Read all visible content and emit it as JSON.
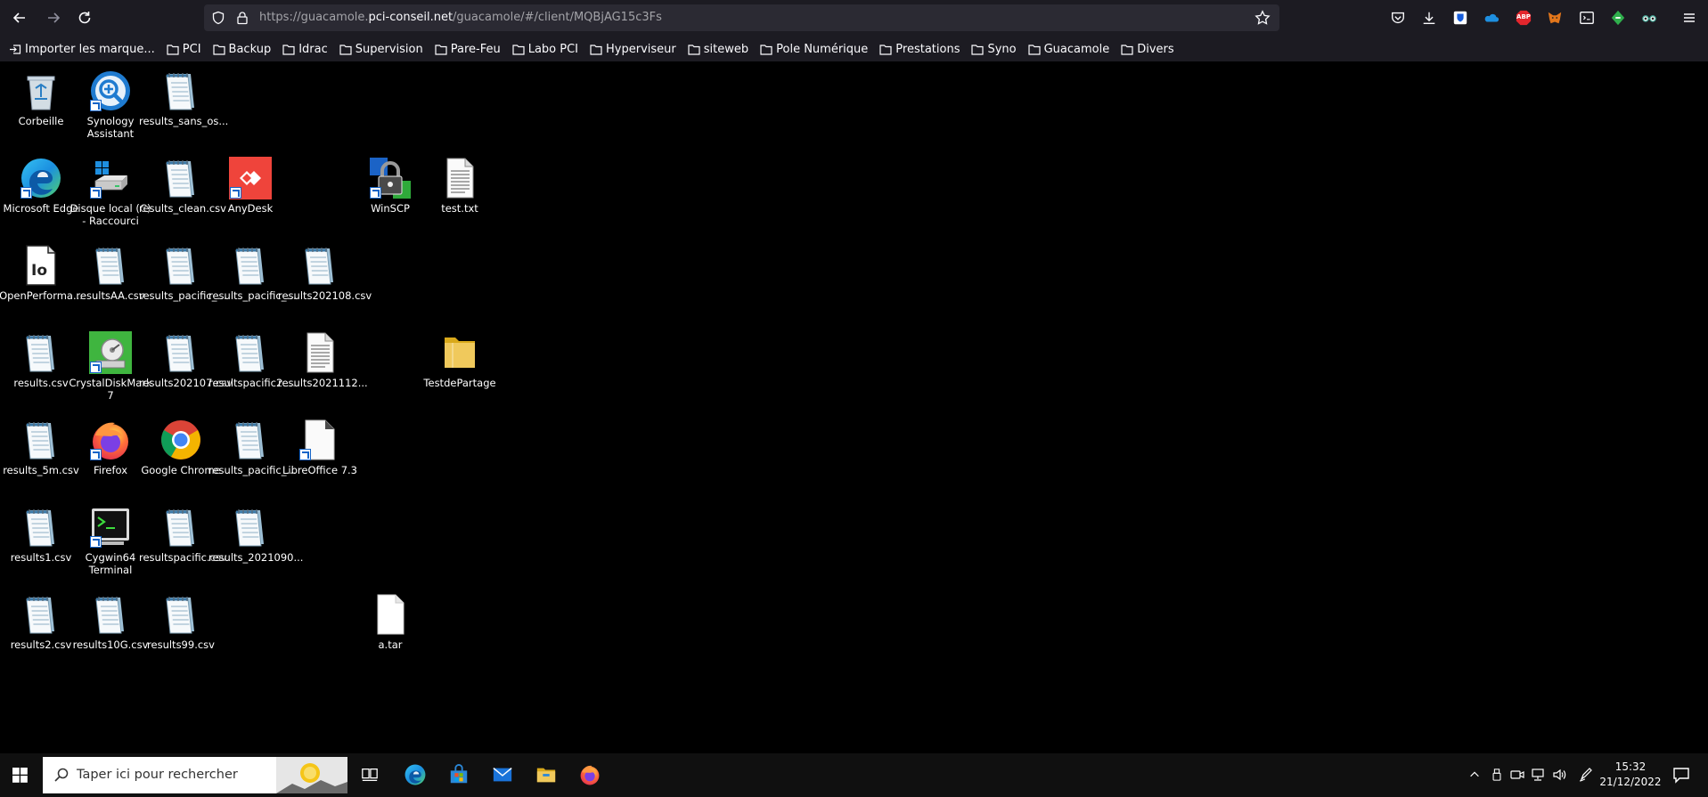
{
  "browser": {
    "url_prefix": "https://guacamole.",
    "url_host": "pci-conseil.net",
    "url_path": "/guacamole/#/client/MQBjAG15c3Fs",
    "extensions": [
      {
        "name": "pocket-icon",
        "label": ""
      },
      {
        "name": "download-icon",
        "label": ""
      },
      {
        "name": "bitwarden-icon",
        "label": ""
      },
      {
        "name": "onedrive-icon",
        "label": ""
      },
      {
        "name": "adblock-icon",
        "label": "ABP"
      },
      {
        "name": "metamask-icon",
        "label": ""
      },
      {
        "name": "devtools-icon",
        "label": ""
      },
      {
        "name": "green-extension-icon",
        "label": ""
      },
      {
        "name": "glasses-extension-icon",
        "label": ""
      }
    ]
  },
  "bookmarks": [
    {
      "label": "Importer les marque...",
      "type": "import"
    },
    {
      "label": "PCI",
      "type": "folder"
    },
    {
      "label": "Backup",
      "type": "folder"
    },
    {
      "label": "Idrac",
      "type": "folder"
    },
    {
      "label": "Supervision",
      "type": "folder"
    },
    {
      "label": "Pare-Feu",
      "type": "folder"
    },
    {
      "label": "Labo PCI",
      "type": "folder"
    },
    {
      "label": "Hyperviseur",
      "type": "folder"
    },
    {
      "label": "siteweb",
      "type": "folder"
    },
    {
      "label": "Pole Numérique",
      "type": "folder"
    },
    {
      "label": "Prestations",
      "type": "folder"
    },
    {
      "label": "Syno",
      "type": "folder"
    },
    {
      "label": "Guacamole",
      "type": "folder"
    },
    {
      "label": "Divers",
      "type": "folder"
    }
  ],
  "desktop_icons": [
    {
      "label": "Corbeille",
      "icon": "recycle-bin-icon",
      "shortcut": false
    },
    {
      "label": "Synology Assistant",
      "icon": "synology-assistant-icon",
      "shortcut": true
    },
    {
      "label": "results_sans_os...",
      "icon": "notepad-file-icon",
      "shortcut": false
    },
    {
      "label": "Microsoft Edge",
      "icon": "edge-icon",
      "shortcut": true
    },
    {
      "label": "Disque local (C) - Raccourci",
      "icon": "local-disk-icon",
      "shortcut": true
    },
    {
      "label": "results_clean.csv",
      "icon": "notepad-file-icon",
      "shortcut": false
    },
    {
      "label": "AnyDesk",
      "icon": "anydesk-icon",
      "shortcut": true
    },
    {
      "label": "WinSCP",
      "icon": "winscp-icon",
      "shortcut": true
    },
    {
      "label": "test.txt",
      "icon": "text-file-icon",
      "shortcut": false
    },
    {
      "label": "OpenPerforma...",
      "icon": "openperformance-icon",
      "shortcut": false
    },
    {
      "label": "resultsAA.csv",
      "icon": "notepad-file-icon",
      "shortcut": false
    },
    {
      "label": "results_pacific_...",
      "icon": "notepad-file-icon",
      "shortcut": false
    },
    {
      "label": "results_pacific_...",
      "icon": "notepad-file-icon",
      "shortcut": false
    },
    {
      "label": "results202108.csv",
      "icon": "notepad-file-icon",
      "shortcut": false
    },
    {
      "label": "results.csv",
      "icon": "notepad-file-icon",
      "shortcut": false
    },
    {
      "label": "CrystalDiskMark 7",
      "icon": "crystaldiskmark-icon",
      "shortcut": true
    },
    {
      "label": "results202107.csv",
      "icon": "notepad-file-icon",
      "shortcut": false
    },
    {
      "label": "resultspacific2....",
      "icon": "notepad-file-icon",
      "shortcut": false
    },
    {
      "label": "results2021112...",
      "icon": "text-file-icon",
      "shortcut": false
    },
    {
      "label": "TestdePartage",
      "icon": "folder-icon",
      "shortcut": false
    },
    {
      "label": "results_5m.csv",
      "icon": "notepad-file-icon",
      "shortcut": false
    },
    {
      "label": "Firefox",
      "icon": "firefox-icon",
      "shortcut": true
    },
    {
      "label": "Google Chrome",
      "icon": "chrome-icon",
      "shortcut": false
    },
    {
      "label": "results_pacific_...",
      "icon": "notepad-file-icon",
      "shortcut": false
    },
    {
      "label": "LibreOffice 7.3",
      "icon": "libreoffice-icon",
      "shortcut": true
    },
    {
      "label": "results1.csv",
      "icon": "notepad-file-icon",
      "shortcut": false
    },
    {
      "label": "Cygwin64 Terminal",
      "icon": "cygwin-terminal-icon",
      "shortcut": true
    },
    {
      "label": "resultspacific.csv",
      "icon": "notepad-file-icon",
      "shortcut": false
    },
    {
      "label": "results_2021090...",
      "icon": "notepad-file-icon",
      "shortcut": false
    },
    {
      "label": "results2.csv",
      "icon": "notepad-file-icon",
      "shortcut": false
    },
    {
      "label": "results10G.csv",
      "icon": "notepad-file-icon",
      "shortcut": false
    },
    {
      "label": "results99.csv",
      "icon": "notepad-file-icon",
      "shortcut": false
    },
    {
      "label": "a.tar",
      "icon": "blank-file-icon",
      "shortcut": false
    }
  ],
  "taskbar": {
    "search_placeholder": "Taper ici pour rechercher",
    "apps": [
      "task-view-icon",
      "edge-icon",
      "microsoft-store-icon",
      "mail-icon",
      "file-explorer-icon",
      "firefox-icon"
    ],
    "tray": [
      "chevron-up-icon",
      "usb-icon",
      "meet-now-icon",
      "network-icon",
      "volume-icon",
      "pen-icon"
    ],
    "time": "15:32",
    "date": "21/12/2022"
  },
  "colors": {
    "chrome_bg": "#1c1b22",
    "urlbar_bg": "#2b2a33",
    "taskbar_bg": "#101010",
    "desktop_bg": "#000000",
    "folder_yellow": "#f0c95c"
  }
}
